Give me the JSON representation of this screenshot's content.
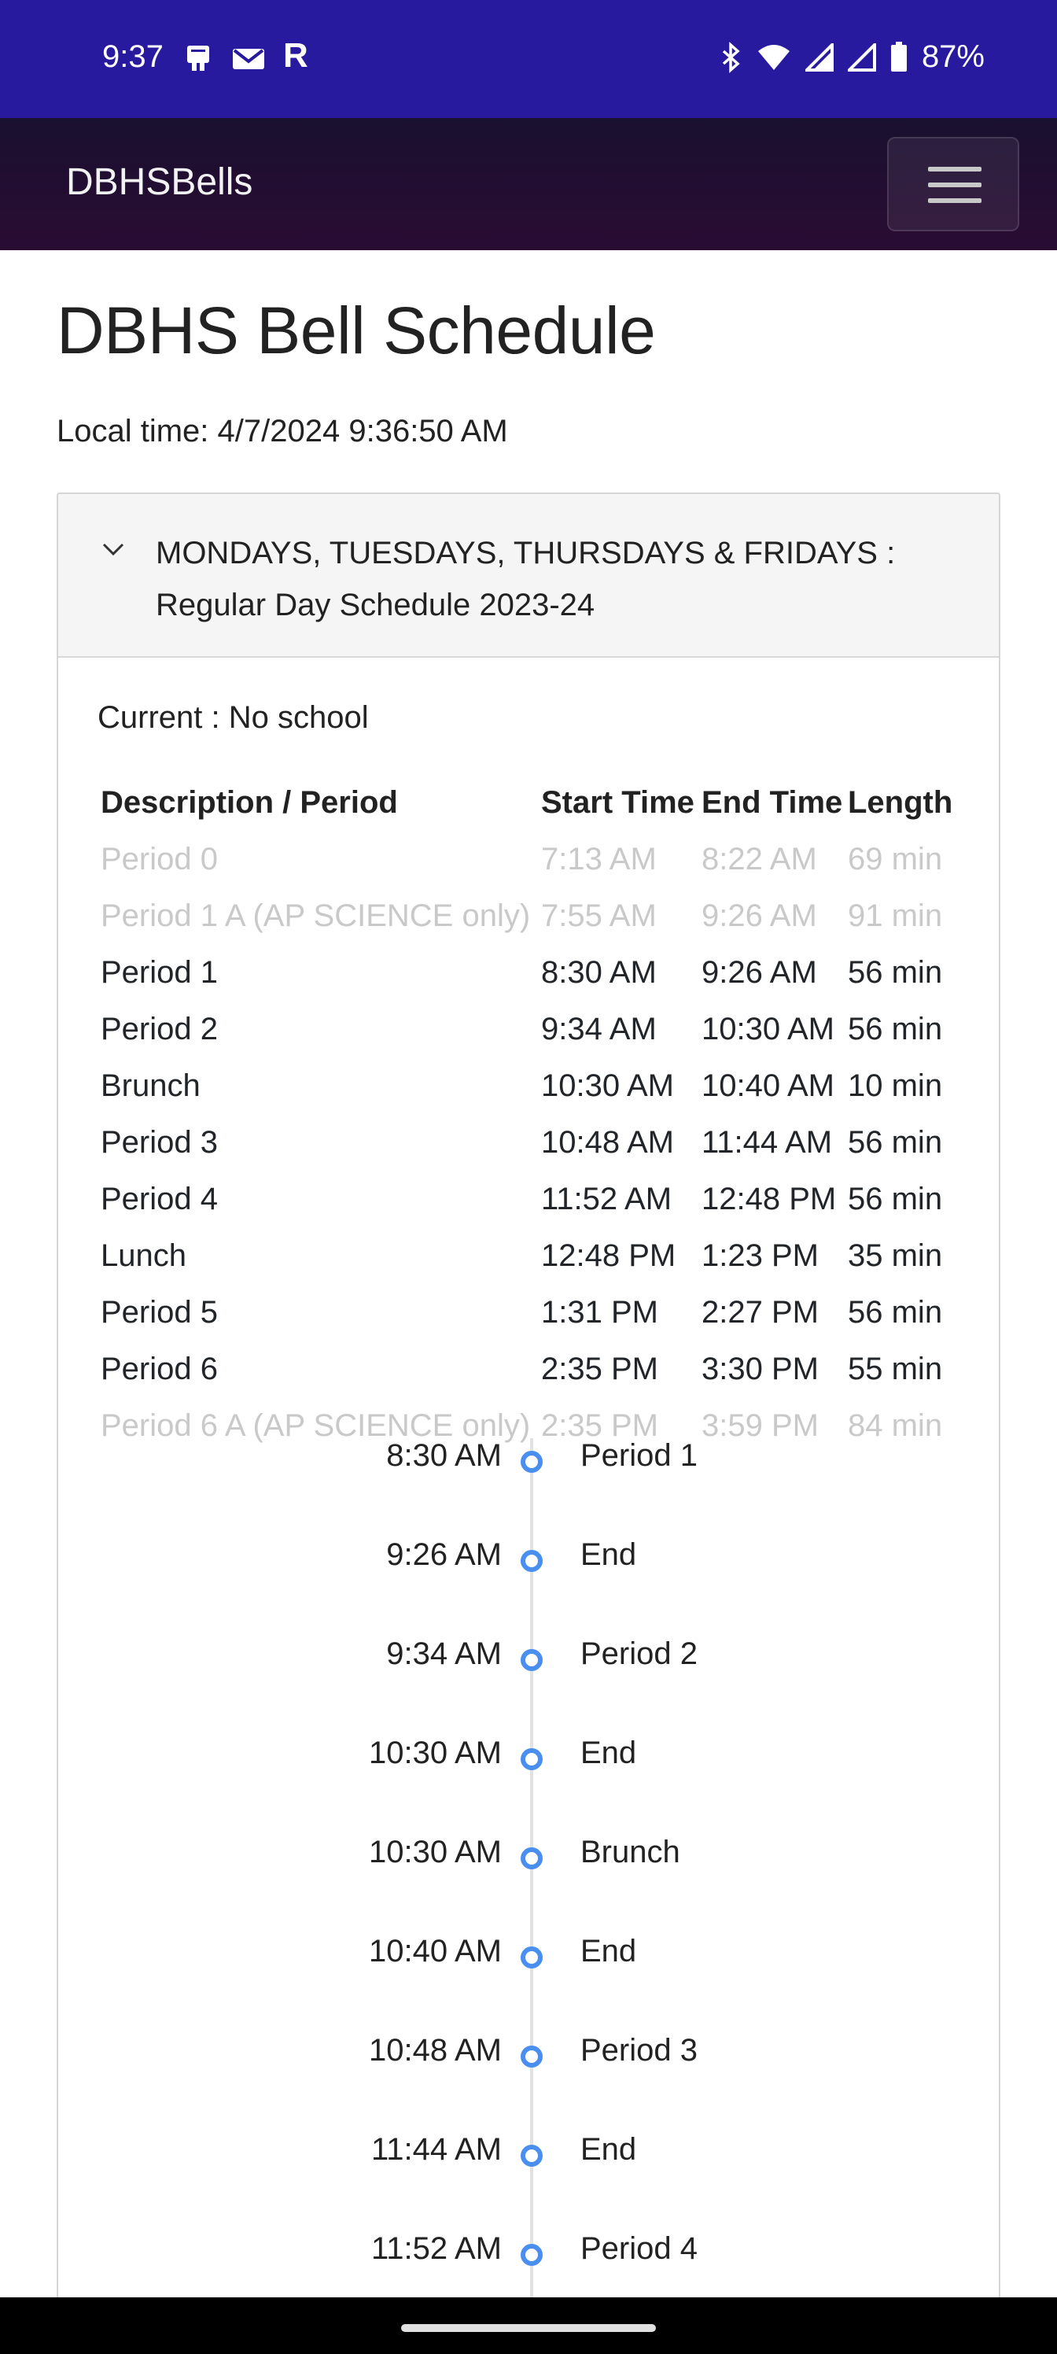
{
  "status_bar": {
    "time": "9:37",
    "left_icons": [
      "phone-icon",
      "mail-icon",
      "r-icon"
    ],
    "r_glyph": "R",
    "battery": "87%",
    "right_icons": [
      "bluetooth-icon",
      "wifi-icon",
      "signal-icon",
      "signal-icon",
      "battery-icon"
    ]
  },
  "navbar": {
    "brand": "DBHSBells",
    "menu_icon": "hamburger-icon"
  },
  "page": {
    "title": "DBHS Bell Schedule",
    "local_time": "Local time: 4/7/2024 9:36:50 AM"
  },
  "accordion": {
    "chevron_icon": "chevron-down-icon",
    "header_line1": "MONDAYS, TUESDAYS, THURSDAYS & FRIDAYS :",
    "header_line2": "Regular Day Schedule 2023-24",
    "current": "Current : No school"
  },
  "schedule": {
    "headers": [
      "Description / Period",
      "Start Time",
      "End Time",
      "Length"
    ],
    "rows": [
      {
        "desc": "Period 0",
        "start": "7:13 AM",
        "end": "8:22 AM",
        "length": "69 min",
        "muted": true
      },
      {
        "desc": "Period 1 A (AP SCIENCE only)",
        "start": "7:55 AM",
        "end": "9:26 AM",
        "length": "91 min",
        "muted": true
      },
      {
        "desc": "Period 1",
        "start": "8:30 AM",
        "end": "9:26 AM",
        "length": "56 min",
        "muted": false
      },
      {
        "desc": "Period 2",
        "start": "9:34 AM",
        "end": "10:30 AM",
        "length": "56 min",
        "muted": false
      },
      {
        "desc": "Brunch",
        "start": "10:30 AM",
        "end": "10:40 AM",
        "length": "10 min",
        "muted": false
      },
      {
        "desc": "Period 3",
        "start": "10:48 AM",
        "end": "11:44 AM",
        "length": "56 min",
        "muted": false
      },
      {
        "desc": "Period 4",
        "start": "11:52 AM",
        "end": "12:48 PM",
        "length": "56 min",
        "muted": false
      },
      {
        "desc": "Lunch",
        "start": "12:48 PM",
        "end": "1:23 PM",
        "length": "35 min",
        "muted": false
      },
      {
        "desc": "Period 5",
        "start": "1:31 PM",
        "end": "2:27 PM",
        "length": "56 min",
        "muted": false
      },
      {
        "desc": "Period 6",
        "start": "2:35 PM",
        "end": "3:30 PM",
        "length": "55 min",
        "muted": false
      },
      {
        "desc": "Period 6 A (AP SCIENCE only)",
        "start": "2:35 PM",
        "end": "3:59 PM",
        "length": "84 min",
        "muted": true
      }
    ]
  },
  "timeline": [
    {
      "time": "8:30 AM",
      "label": "Period 1"
    },
    {
      "time": "9:26 AM",
      "label": "End"
    },
    {
      "time": "9:34 AM",
      "label": "Period 2"
    },
    {
      "time": "10:30 AM",
      "label": "End"
    },
    {
      "time": "10:30 AM",
      "label": "Brunch"
    },
    {
      "time": "10:40 AM",
      "label": "End"
    },
    {
      "time": "10:48 AM",
      "label": "Period 3"
    },
    {
      "time": "11:44 AM",
      "label": "End"
    },
    {
      "time": "11:52 AM",
      "label": "Period 4"
    }
  ],
  "colors": {
    "status_bar": "#281a9e",
    "timeline_dot": "#4a8ff0",
    "muted_text": "#c9c9c9"
  }
}
